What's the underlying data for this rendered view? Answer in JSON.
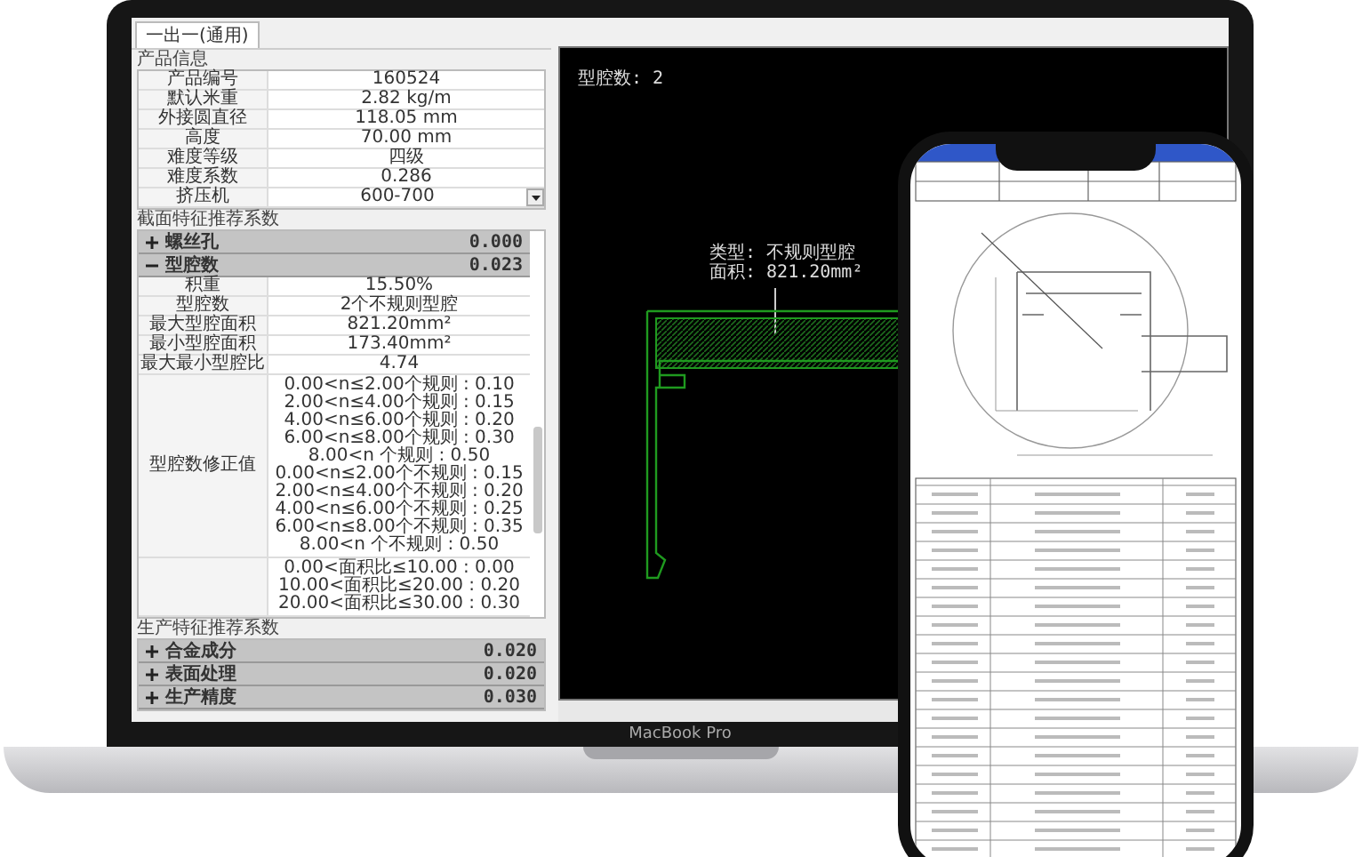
{
  "tab": {
    "label": "一出一(通用)",
    "selected": true
  },
  "product_info": {
    "title": "产品信息",
    "rows": [
      {
        "label": "产品编号",
        "value": "160524",
        "kind": "text"
      },
      {
        "label": "默认米重",
        "value": "2.82 kg/m",
        "kind": "text"
      },
      {
        "label": "外接圆直径",
        "value": "118.05 mm",
        "kind": "text"
      },
      {
        "label": "高度",
        "value": "70.00 mm",
        "kind": "text"
      },
      {
        "label": "难度等级",
        "value": "四级",
        "kind": "text"
      },
      {
        "label": "难度系数",
        "value": "0.286",
        "kind": "text"
      },
      {
        "label": "挤压机",
        "value": "600-700",
        "kind": "dropdown"
      }
    ]
  },
  "section_features": {
    "title": "截面特征推荐系数",
    "groups": [
      {
        "label": "螺丝孔",
        "value": "0.000",
        "expanded": false
      },
      {
        "label": "型腔数",
        "value": "0.023",
        "expanded": true,
        "rows": [
          {
            "label": "积重",
            "lines": [
              "15.50%"
            ]
          },
          {
            "label": "型腔数",
            "lines": [
              "2个不规则型腔"
            ]
          },
          {
            "label": "最大型腔面积",
            "lines": [
              "821.20mm²"
            ]
          },
          {
            "label": "最小型腔面积",
            "lines": [
              "173.40mm²"
            ]
          },
          {
            "label": "最大最小型腔比",
            "lines": [
              "4.74"
            ]
          },
          {
            "label": "型腔数修正值",
            "lines": [
              "0.00<n≤2.00个规则 : 0.10",
              "2.00<n≤4.00个规则 : 0.15",
              "4.00<n≤6.00个规则 : 0.20",
              "6.00<n≤8.00个规则 : 0.30",
              "8.00<n 个规则 : 0.50",
              "0.00<n≤2.00个不规则 : 0.15",
              "2.00<n≤4.00个不规则 : 0.20",
              "4.00<n≤6.00个不规则 : 0.25",
              "6.00<n≤8.00个不规则 : 0.35",
              "8.00<n 个不规则 : 0.50"
            ]
          },
          {
            "lines": [
              "0.00<面积比≤10.00 : 0.00",
              "10.00<面积比≤20.00 : 0.20",
              "20.00<面积比≤30.00 : 0.30"
            ]
          }
        ]
      }
    ]
  },
  "production_features": {
    "title": "生产特征推荐系数",
    "groups": [
      {
        "label": "合金成分",
        "value": "0.020",
        "expanded": false
      },
      {
        "label": "表面处理",
        "value": "0.020",
        "expanded": false
      },
      {
        "label": "生产精度",
        "value": "0.030",
        "expanded": false
      }
    ]
  },
  "canvas": {
    "cavity_count": "型腔数: 2",
    "annotation": [
      "类型: 不规则型腔",
      "面积: 821.20mm²"
    ]
  },
  "laptop_label": "MacBook Pro"
}
